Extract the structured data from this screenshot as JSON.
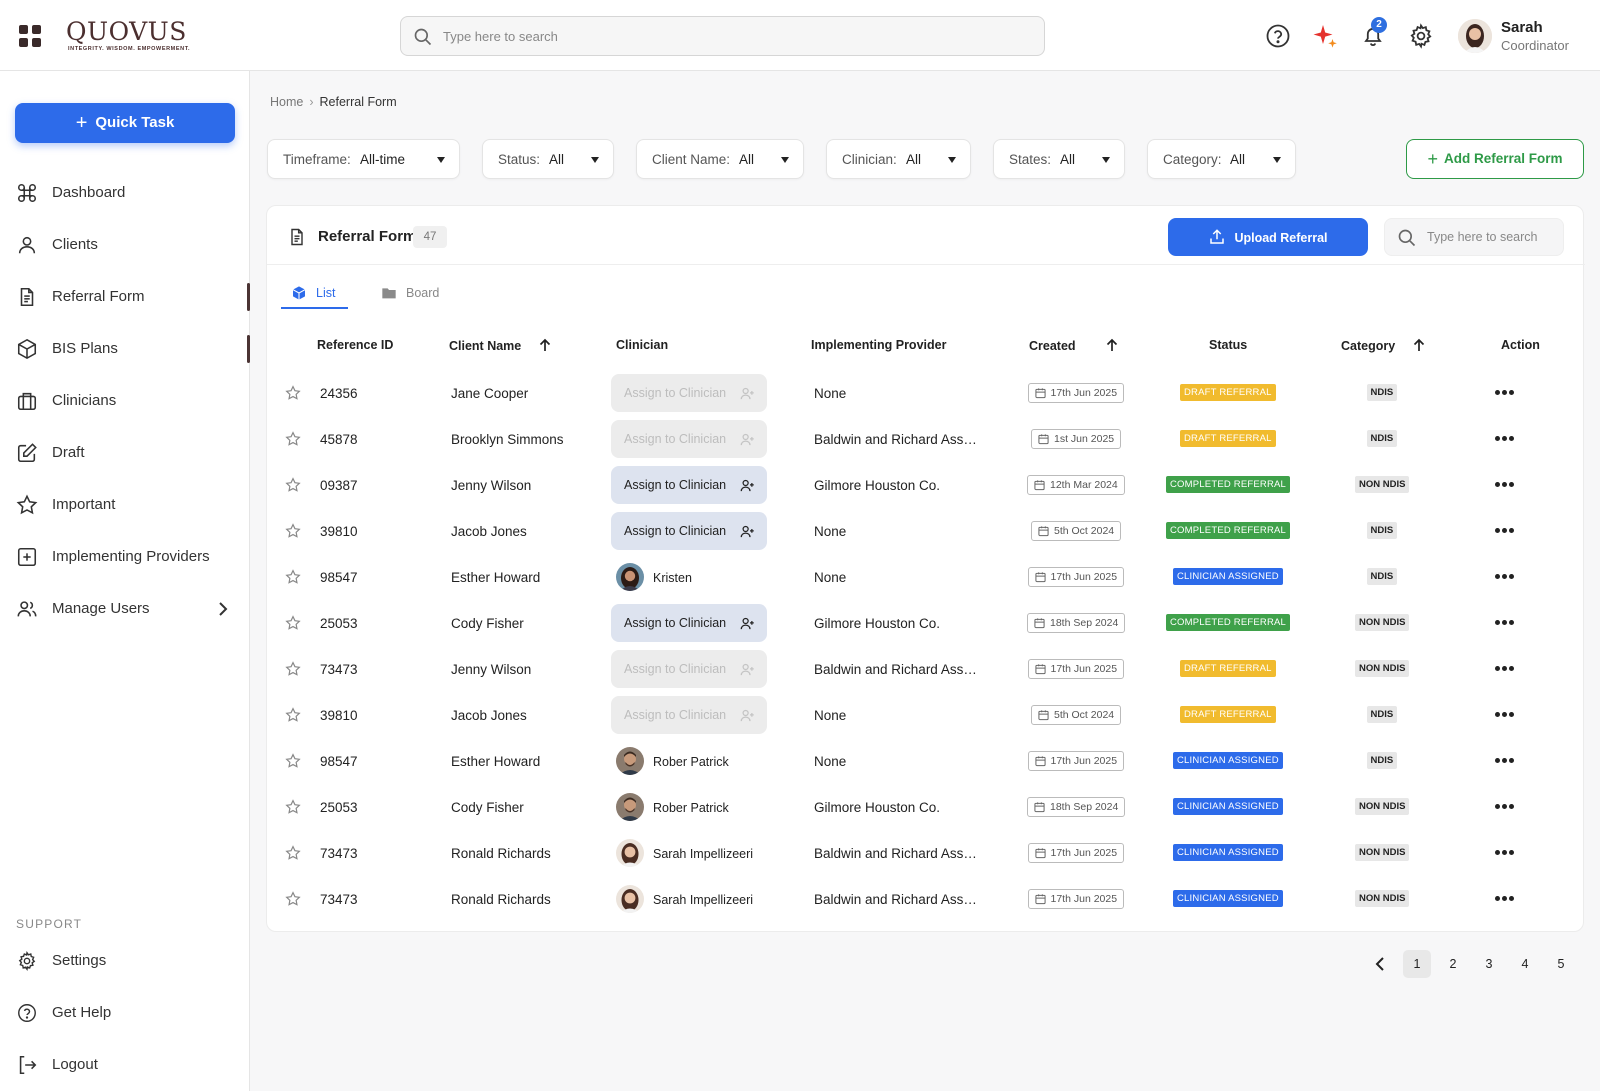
{
  "header": {
    "logo_text": "QUOVUS",
    "logo_tagline": "INTEGRITY. WISDOM. EMPOWERMENT.",
    "search_placeholder": "Type here to search",
    "notification_count": "2",
    "user_name": "Sarah",
    "user_role": "Coordinator"
  },
  "sidebar": {
    "quick_task_label": "Quick Task",
    "items": [
      {
        "label": "Dashboard",
        "icon": "command-icon"
      },
      {
        "label": "Clients",
        "icon": "person-icon"
      },
      {
        "label": "Referral Form",
        "icon": "document-icon"
      },
      {
        "label": "BIS Plans",
        "icon": "cube-icon"
      },
      {
        "label": "Clinicians",
        "icon": "building-icon"
      },
      {
        "label": "Draft",
        "icon": "edit-icon"
      },
      {
        "label": "Important",
        "icon": "star-icon"
      },
      {
        "label": "Implementing Providers",
        "icon": "plus-square-icon"
      },
      {
        "label": "Manage Users",
        "icon": "users-icon"
      }
    ],
    "support_label": "SUPPORT",
    "support_items": [
      {
        "label": "Settings",
        "icon": "gear-icon"
      },
      {
        "label": "Get Help",
        "icon": "help-icon"
      },
      {
        "label": "Logout",
        "icon": "logout-icon"
      }
    ]
  },
  "breadcrumb": {
    "home": "Home",
    "current": "Referral Form"
  },
  "filters": [
    {
      "label": "Timeframe:",
      "value": "All-time"
    },
    {
      "label": "Status:",
      "value": "All"
    },
    {
      "label": "Client Name:",
      "value": "All"
    },
    {
      "label": "Clinician:",
      "value": "All"
    },
    {
      "label": "States:",
      "value": "All"
    },
    {
      "label": "Category:",
      "value": "All"
    }
  ],
  "add_referral_label": "Add Referral Form",
  "card": {
    "title": "Referral Form",
    "count": "47",
    "upload_label": "Upload Referral",
    "search_placeholder": "Type here to search",
    "tabs": [
      {
        "label": "List"
      },
      {
        "label": "Board"
      }
    ]
  },
  "table": {
    "columns": [
      "Reference ID",
      "Client Name",
      "Clinician",
      "Implementing Provider",
      "Created",
      "Status",
      "Category",
      "Action"
    ],
    "assign_label": "Assign to Clinician",
    "rows": [
      {
        "ref": "24356",
        "client": "Jane Cooper",
        "clinician": null,
        "assign_enabled": false,
        "provider": "None",
        "created": "17th Jun 2025",
        "status": "DRAFT REFERRAL",
        "status_kind": "draft",
        "category": "NDIS"
      },
      {
        "ref": "45878",
        "client": "Brooklyn Simmons",
        "clinician": null,
        "assign_enabled": false,
        "provider": "Baldwin and Richard Asso...",
        "created": "1st Jun 2025",
        "status": "DRAFT REFERRAL",
        "status_kind": "draft",
        "category": "NDIS"
      },
      {
        "ref": "09387",
        "client": "Jenny Wilson",
        "clinician": null,
        "assign_enabled": true,
        "provider": "Gilmore Houston Co.",
        "created": "12th Mar 2024",
        "status": "COMPLETED REFERRAL",
        "status_kind": "completed",
        "category": "NON NDIS"
      },
      {
        "ref": "39810",
        "client": "Jacob Jones",
        "clinician": null,
        "assign_enabled": true,
        "provider": "None",
        "created": "5th Oct 2024",
        "status": "COMPLETED REFERRAL",
        "status_kind": "completed",
        "category": "NDIS"
      },
      {
        "ref": "98547",
        "client": "Esther Howard",
        "clinician": "Kristen",
        "avatar": "female-dark",
        "provider": "None",
        "created": "17th Jun 2025",
        "status": "CLINICIAN ASSIGNED",
        "status_kind": "assigned",
        "category": "NDIS"
      },
      {
        "ref": "25053",
        "client": "Cody Fisher",
        "clinician": null,
        "assign_enabled": true,
        "provider": "Gilmore Houston Co.",
        "created": "18th Sep 2024",
        "status": "COMPLETED REFERRAL",
        "status_kind": "completed",
        "category": "NON NDIS"
      },
      {
        "ref": "73473",
        "client": "Jenny Wilson",
        "clinician": null,
        "assign_enabled": false,
        "provider": "Baldwin and Richard Asso...",
        "created": "17th Jun 2025",
        "status": "DRAFT REFERRAL",
        "status_kind": "draft",
        "category": "NON NDIS"
      },
      {
        "ref": "39810",
        "client": "Jacob Jones",
        "clinician": null,
        "assign_enabled": false,
        "provider": "None",
        "created": "5th Oct 2024",
        "status": "DRAFT REFERRAL",
        "status_kind": "draft",
        "category": "NDIS"
      },
      {
        "ref": "98547",
        "client": "Esther Howard",
        "clinician": "Rober Patrick",
        "avatar": "male",
        "provider": "None",
        "created": "17th Jun 2025",
        "status": "CLINICIAN ASSIGNED",
        "status_kind": "assigned",
        "category": "NDIS"
      },
      {
        "ref": "25053",
        "client": "Cody Fisher",
        "clinician": "Rober Patrick",
        "avatar": "male",
        "provider": "Gilmore Houston Co.",
        "created": "18th Sep 2024",
        "status": "CLINICIAN ASSIGNED",
        "status_kind": "assigned",
        "category": "NON NDIS"
      },
      {
        "ref": "73473",
        "client": "Ronald Richards",
        "clinician": "Sarah Impellizeeri",
        "avatar": "female-light",
        "provider": "Baldwin and Richard Asso...",
        "created": "17th Jun 2025",
        "status": "CLINICIAN ASSIGNED",
        "status_kind": "assigned",
        "category": "NON NDIS"
      },
      {
        "ref": "73473",
        "client": "Ronald Richards",
        "clinician": "Sarah Impellizeeri",
        "avatar": "female-light",
        "provider": "Baldwin and Richard Asso...",
        "created": "17th Jun 2025",
        "status": "CLINICIAN ASSIGNED",
        "status_kind": "assigned",
        "category": "NON NDIS"
      }
    ]
  },
  "pagination": {
    "pages": [
      "1",
      "2",
      "3",
      "4",
      "5"
    ],
    "current": "1"
  },
  "colors": {
    "accent": "#2d6bea",
    "success": "#3fa14a",
    "warning": "#f1bb2e",
    "brand": "#4b2f2f"
  }
}
